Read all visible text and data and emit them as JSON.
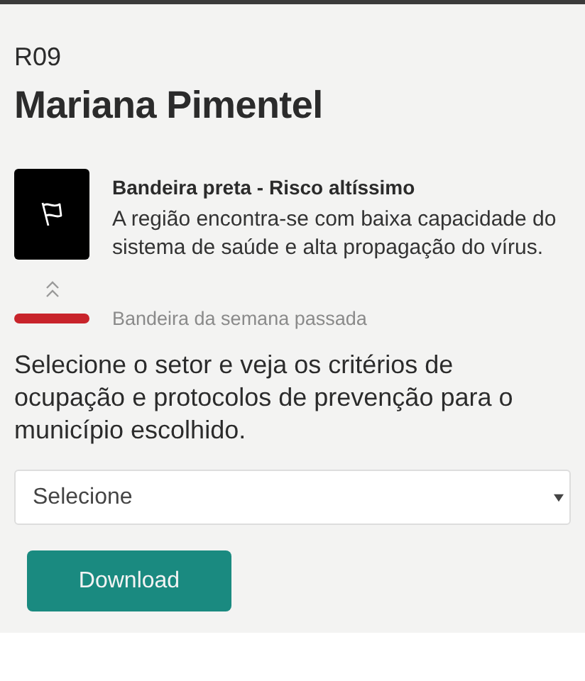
{
  "region_code": "R09",
  "region_name": "Mariana Pimentel",
  "current_flag": {
    "color": "#000000",
    "title": "Bandeira preta - Risco altíssimo",
    "description": "A região encontra-se com baixa capacidade do sistema de saúde e alta propagação do vírus."
  },
  "previous_flag": {
    "color": "#c8242b",
    "label": "Bandeira da semana passada"
  },
  "instructions": "Selecione o setor e veja os critérios de ocupação e protocolos de prevenção para o município escolhido.",
  "sector_select": {
    "placeholder": "Selecione"
  },
  "download_button": "Download"
}
